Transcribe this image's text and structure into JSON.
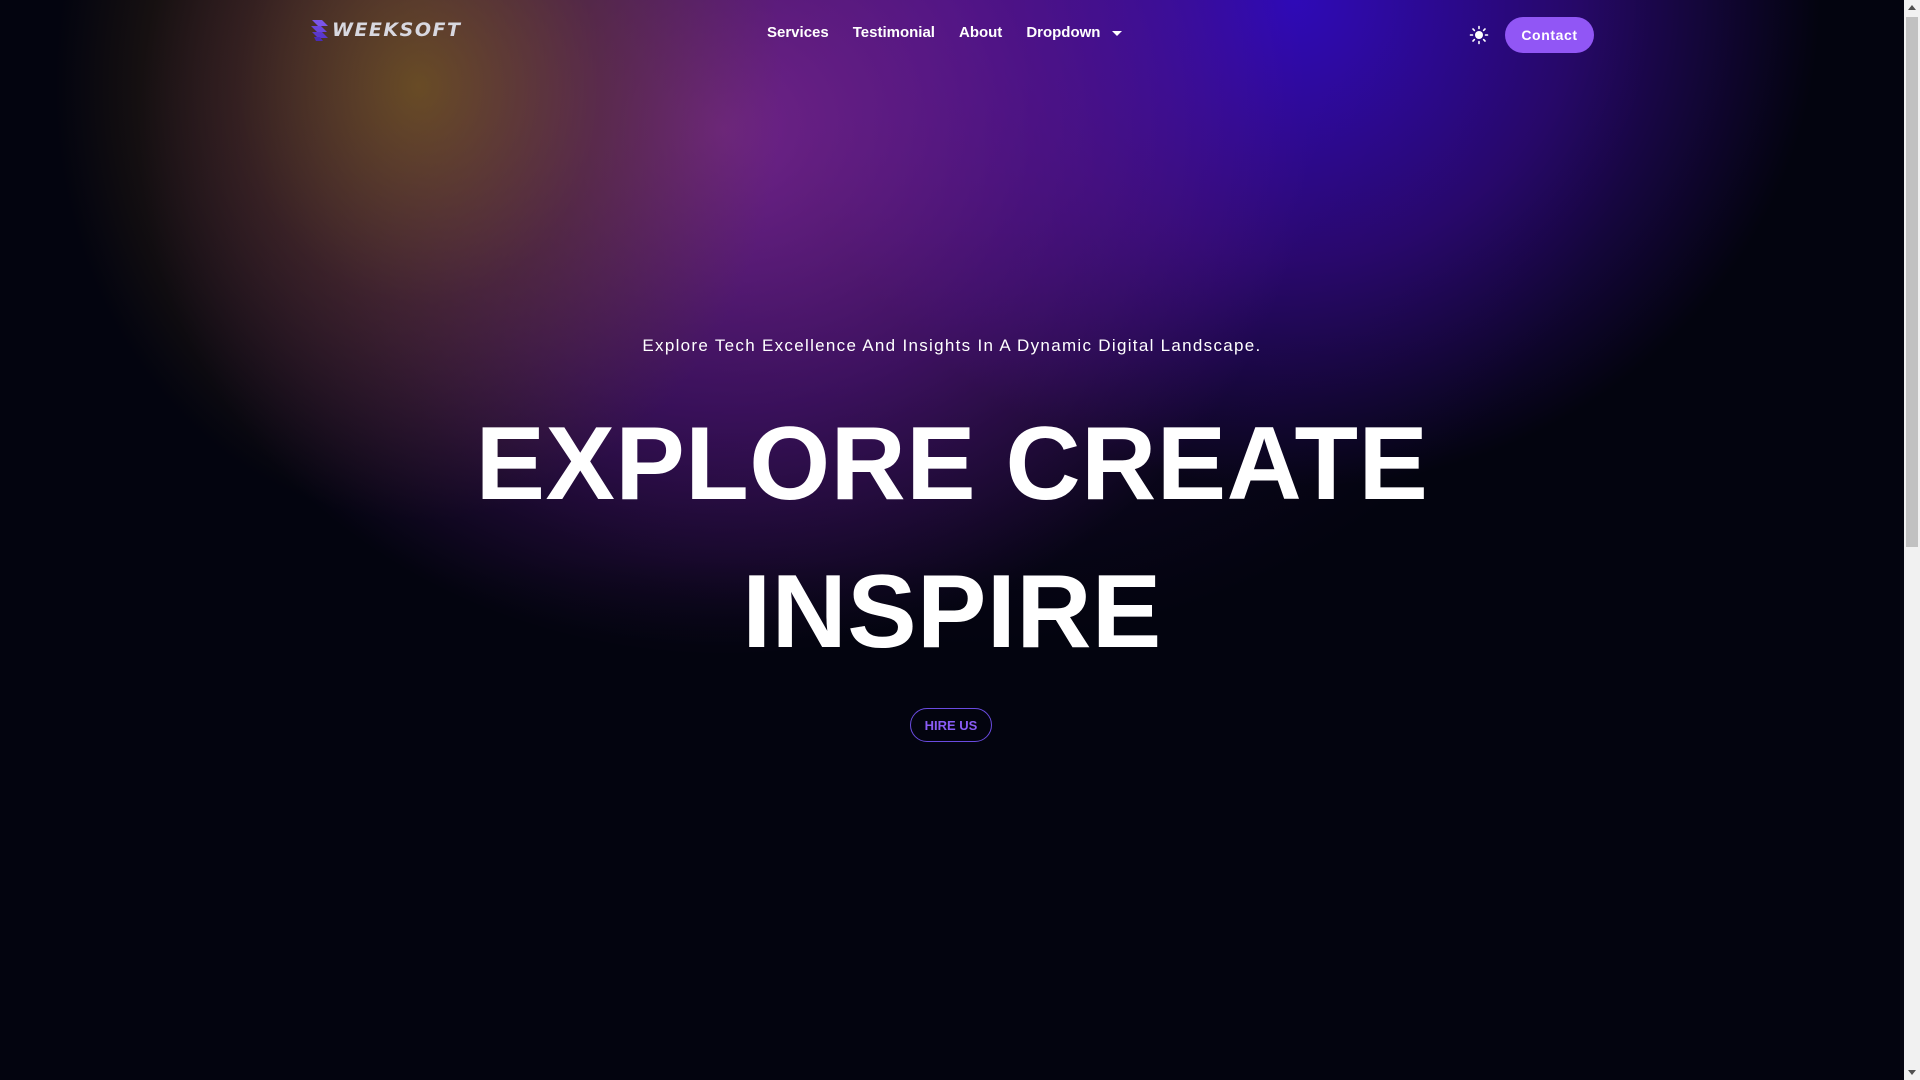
{
  "brand": {
    "name": "WEEKSOFT",
    "accent_color": "#9156f5"
  },
  "nav": {
    "items": [
      {
        "label": "Services"
      },
      {
        "label": "Testimonial"
      },
      {
        "label": "About"
      },
      {
        "label": "Dropdown",
        "icon": "caret-down-icon"
      }
    ],
    "theme_toggle_icon": "sun-icon",
    "contact_label": "Contact"
  },
  "hero": {
    "tagline": "Explore Tech Excellence And Insights In A Dynamic Digital Landscape.",
    "headline_line1": "EXPLORE CREATE",
    "headline_line2": "INSPIRE",
    "cta_label": "HIRE US"
  }
}
